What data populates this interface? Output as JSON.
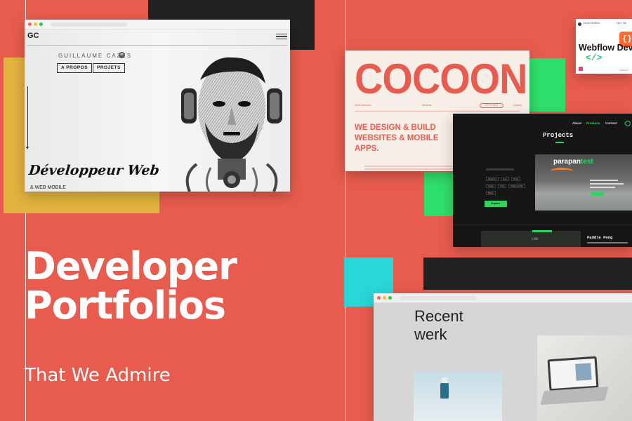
{
  "colors": {
    "background": "#e85c4f",
    "accent_yellow": "#e2b33f",
    "accent_green": "#2ee06b",
    "accent_cyan": "#29d7d7",
    "block_dark": "#222222"
  },
  "headline": {
    "line1": "Developer",
    "line2": "Portfolios",
    "subtitle": "That We Admire"
  },
  "window_guillaume": {
    "logo": "GC",
    "name": "GUILLAUME CAZES",
    "name_badge": "m",
    "nav": [
      "A PROPOS",
      "PROJETS"
    ],
    "script_title": "Développeur Web",
    "subtitle": "& WEB MOBILE",
    "icons": [
      "hamburger-icon",
      "down-arrow-icon"
    ]
  },
  "window_cocoon": {
    "brand": "COCOON",
    "nav_left": "Work Overview",
    "nav_mid": "Services",
    "nav_right": "Contact",
    "pill": "LET'S TALK",
    "headline": "WE DESIGN & BUILD WEBSITES & MOBILE APPS.",
    "box_text": "NEED A NEW COMPANY WEBSITE OR MOBILE APP?"
  },
  "window_webflow": {
    "author": "Clovis Webflow",
    "top_right": "Open Tab",
    "title": "Webflow Dev",
    "code_glyph": "</>",
    "icon_glyph": "{}",
    "footer": "Webflow"
  },
  "window_projects": {
    "nav": [
      "About",
      "Products",
      "Contact"
    ],
    "active_nav": "Products",
    "title": "Projects",
    "card_title_a": "parapan",
    "card_title_b": "test",
    "tags": [
      "React JS",
      "Next",
      "Node",
      "Strapi",
      "CSS",
      "Tailwind CSS",
      "REST"
    ],
    "button": "Explore",
    "second_label": "LOG",
    "second_title": "Paddle Pong"
  },
  "window_recent": {
    "heading_line1": "Recent",
    "heading_line2": "werk"
  }
}
